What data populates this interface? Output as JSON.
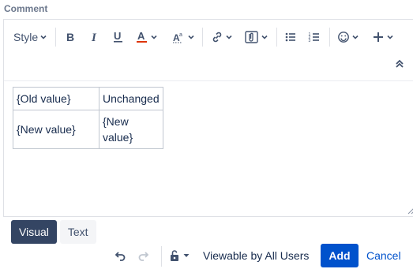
{
  "comment_label": "Comment",
  "toolbar": {
    "style_label": "Style",
    "icons": [
      "bold-icon",
      "italic-icon",
      "underline-icon",
      "text-color-icon",
      "text-effects-icon",
      "link-icon",
      "attachment-icon",
      "bullet-list-icon",
      "numbered-list-icon",
      "emoji-icon",
      "insert-more-icon",
      "collapse-toolbar-icon"
    ],
    "text_color": "#de350b"
  },
  "table": {
    "rows": [
      [
        "{Old value}",
        "Unchanged"
      ],
      [
        "{New value}",
        "{New value}"
      ]
    ]
  },
  "modes": {
    "visual_label": "Visual",
    "text_label": "Text",
    "active": "Visual"
  },
  "footer": {
    "restriction_text": "Viewable by All Users",
    "add_label": "Add",
    "cancel_label": "Cancel"
  },
  "colors": {
    "primary": "#0052cc",
    "active_tab": "#344563",
    "label": "#6b778c"
  }
}
